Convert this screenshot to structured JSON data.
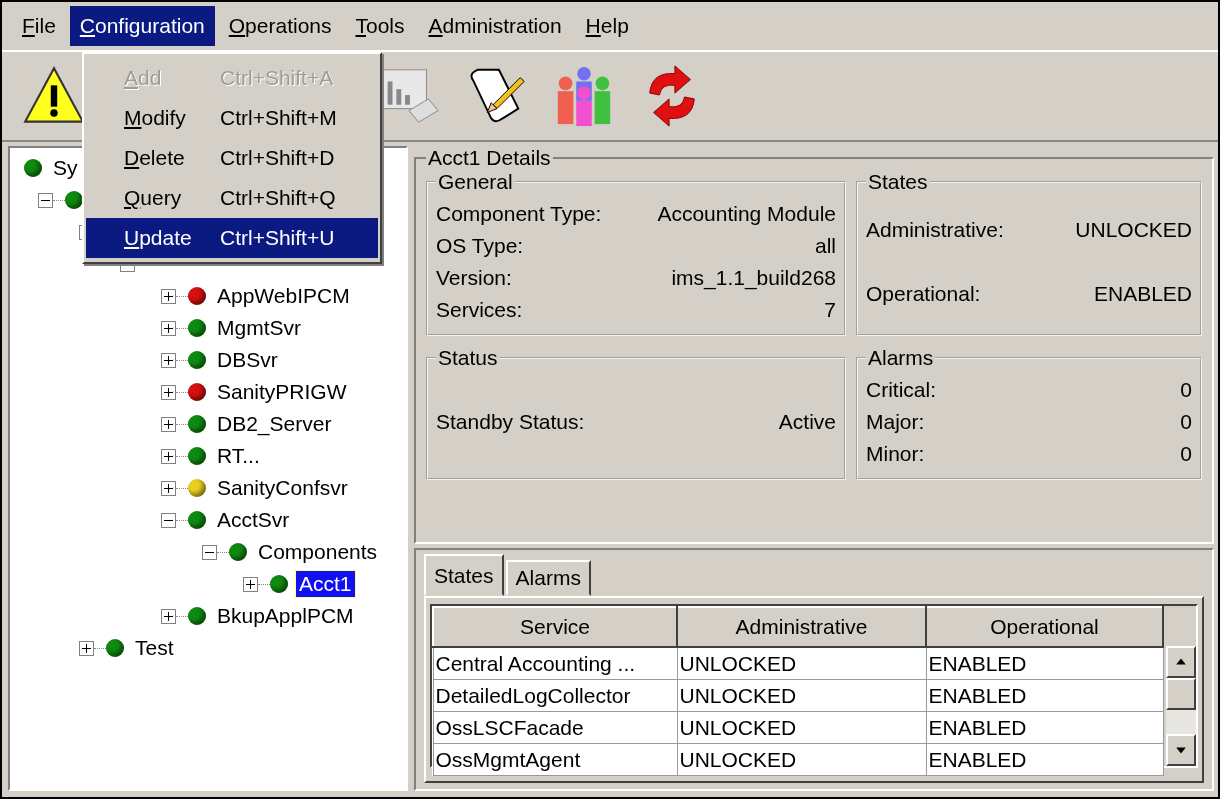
{
  "menubar": [
    {
      "label": "File",
      "selected": false
    },
    {
      "label": "Configuration",
      "selected": true
    },
    {
      "label": "Operations",
      "selected": false
    },
    {
      "label": "Tools",
      "selected": false
    },
    {
      "label": "Administration",
      "selected": false
    },
    {
      "label": "Help",
      "selected": false
    }
  ],
  "menu": [
    {
      "label": "Add",
      "shortcut": "Ctrl+Shift+A",
      "disabled": true,
      "selected": false
    },
    {
      "label": "Modify",
      "shortcut": "Ctrl+Shift+M",
      "disabled": false,
      "selected": false
    },
    {
      "label": "Delete",
      "shortcut": "Ctrl+Shift+D",
      "disabled": false,
      "selected": false
    },
    {
      "label": "Query",
      "shortcut": "Ctrl+Shift+Q",
      "disabled": false,
      "selected": false
    },
    {
      "label": "Update",
      "shortcut": "Ctrl+Shift+U",
      "disabled": false,
      "selected": true
    }
  ],
  "toolbar": [
    {
      "kind": "warning"
    },
    {
      "kind": "chart"
    },
    {
      "kind": "scroll"
    },
    {
      "kind": "people"
    },
    {
      "kind": "refresh"
    }
  ],
  "tree": [
    {
      "label": "Sy",
      "color": "#108a10",
      "selected": false,
      "children": [
        {
          "color": "#108a10",
          "expanded": true,
          "children": [
            {
              "expanded": true,
              "children": [
                {
                  "expanded": true,
                  "children": [
                    {
                      "label": "AppWebIPCM",
                      "color": "#d81010",
                      "expanded": false,
                      "selected": false
                    },
                    {
                      "label": "MgmtSvr",
                      "color": "#108a10",
                      "expanded": false,
                      "selected": false
                    },
                    {
                      "label": "DBSvr",
                      "color": "#108a10",
                      "expanded": false,
                      "selected": false
                    },
                    {
                      "label": "SanityPRIGW",
                      "color": "#d81010",
                      "expanded": false,
                      "selected": false
                    },
                    {
                      "label": "DB2_Server",
                      "color": "#108a10",
                      "expanded": false,
                      "selected": false
                    },
                    {
                      "label": "RT...",
                      "color": "#108a10",
                      "expanded": false,
                      "selected": false
                    },
                    {
                      "label": "SanityConfsvr",
                      "color": "#e8d020",
                      "expanded": false,
                      "selected": false
                    },
                    {
                      "label": "AcctSvr",
                      "color": "#108a10",
                      "expanded": true,
                      "selected": false,
                      "children": [
                        {
                          "label": "Components",
                          "color": "#108a10",
                          "expanded": true,
                          "selected": false,
                          "children": [
                            {
                              "label": "Acct1",
                              "color": "#108a10",
                              "expanded": false,
                              "selected": true
                            }
                          ]
                        }
                      ]
                    },
                    {
                      "label": "BkupApplPCM",
                      "color": "#108a10",
                      "expanded": false,
                      "selected": false
                    }
                  ]
                }
              ]
            },
            {
              "label": "Test",
              "color": "#108a10",
              "expanded": false,
              "selected": false
            }
          ]
        }
      ]
    }
  ],
  "details": {
    "title": "Acct1 Details",
    "general": {
      "title": "General",
      "rows": [
        {
          "label": "Component Type:",
          "value": "Accounting Module"
        },
        {
          "label": "OS Type:",
          "value": "all"
        },
        {
          "label": "Version:",
          "value": "ims_1.1_build268"
        },
        {
          "label": "Services:",
          "value": "7"
        }
      ]
    },
    "states": {
      "title": "States",
      "rows": [
        {
          "label": "Administrative:",
          "value": "UNLOCKED"
        },
        {
          "label": "Operational:",
          "value": "ENABLED"
        }
      ]
    },
    "status": {
      "title": "Status",
      "rows": [
        {
          "label": "Standby Status:",
          "value": "Active"
        }
      ]
    },
    "alarms": {
      "title": "Alarms",
      "rows": [
        {
          "label": "Critical:",
          "value": "0"
        },
        {
          "label": "Major:",
          "value": "0"
        },
        {
          "label": "Minor:",
          "value": "0"
        }
      ]
    }
  },
  "tabs": [
    {
      "label": "States",
      "selected": true
    },
    {
      "label": "Alarms",
      "selected": false
    }
  ],
  "table": {
    "columns": [
      "Service",
      "Administrative",
      "Operational"
    ],
    "rows": [
      [
        "Central Accounting ...",
        "UNLOCKED",
        "ENABLED"
      ],
      [
        "DetailedLogCollector",
        "UNLOCKED",
        "ENABLED"
      ],
      [
        "OssLSCFacade",
        "UNLOCKED",
        "ENABLED"
      ],
      [
        "OssMgmtAgent",
        "UNLOCKED",
        "ENABLED"
      ]
    ]
  }
}
